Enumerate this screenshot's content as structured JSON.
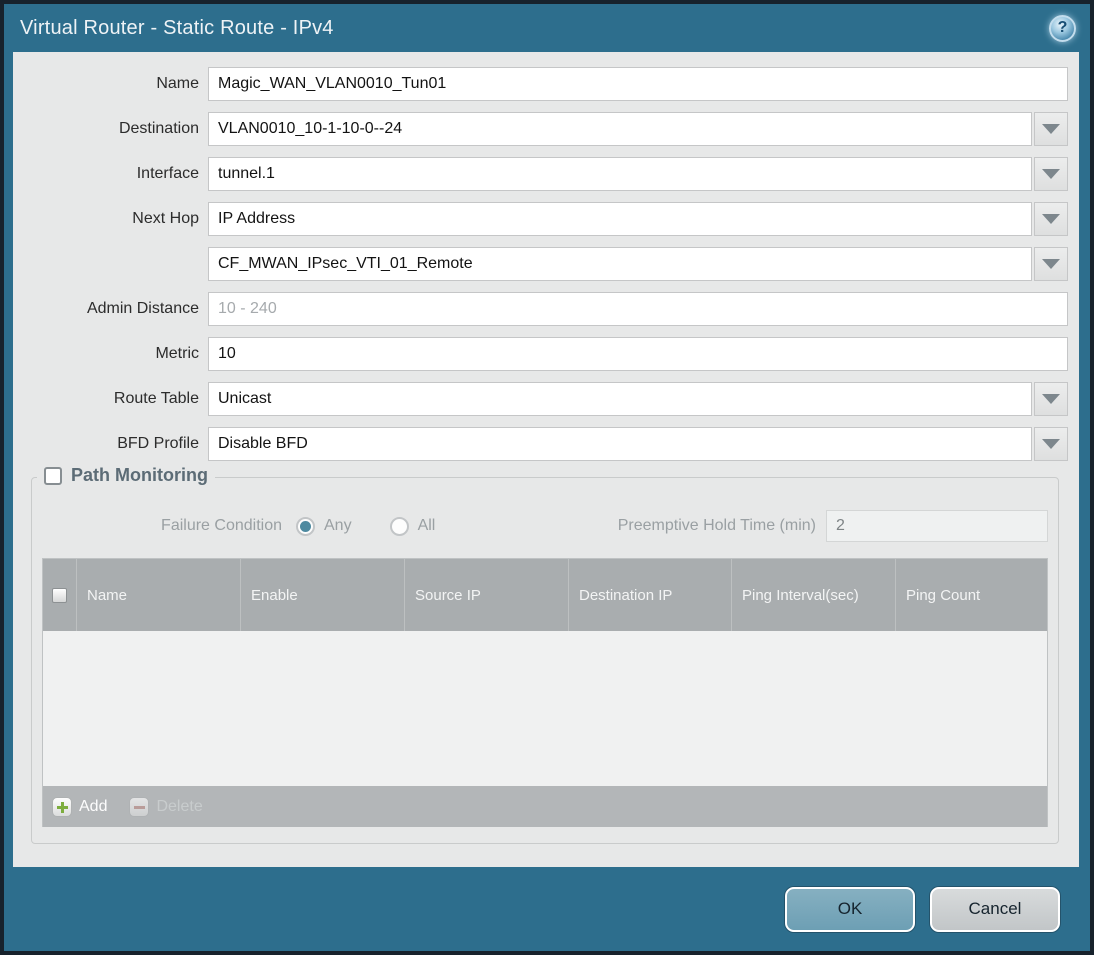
{
  "window": {
    "title": "Virtual Router - Static Route - IPv4",
    "help_glyph": "?"
  },
  "colors": {
    "frame_teal": "#2d6e8d",
    "frame_border": "#17222c",
    "content_bg": "#e7e8e8",
    "table_header_bg": "#a9adaf",
    "ok_button": "#74a5b9",
    "add_plus_green": "#7dad3e",
    "delete_minus_red": "#bd8f8a",
    "radio_selected": "#4e8aa0"
  },
  "form": {
    "rows": [
      {
        "label": "Name",
        "value": "Magic_WAN_VLAN0010_Tun01",
        "type": "text"
      },
      {
        "label": "Destination",
        "value": "VLAN0010_10-1-10-0--24",
        "type": "dropdown"
      },
      {
        "label": "Interface",
        "value": "tunnel.1",
        "type": "dropdown"
      },
      {
        "label": "Next Hop",
        "value": "IP Address",
        "type": "dropdown"
      },
      {
        "label": "",
        "value": "CF_MWAN_IPsec_VTI_01_Remote",
        "type": "dropdown"
      },
      {
        "label": "Admin Distance",
        "value": "",
        "placeholder": "10 - 240",
        "type": "text"
      },
      {
        "label": "Metric",
        "value": "10",
        "type": "text"
      },
      {
        "label": "Route Table",
        "value": "Unicast",
        "type": "dropdown"
      },
      {
        "label": "BFD Profile",
        "value": "Disable BFD",
        "type": "dropdown"
      }
    ]
  },
  "path_monitoring": {
    "legend": "Path Monitoring",
    "checked": false,
    "failure_condition_label": "Failure Condition",
    "options": [
      {
        "label": "Any",
        "selected": true
      },
      {
        "label": "All",
        "selected": false
      }
    ],
    "preemptive_label": "Preemptive Hold Time (min)",
    "preemptive_value": "2",
    "table": {
      "columns": [
        "Name",
        "Enable",
        "Source IP",
        "Destination IP",
        "Ping Interval(sec)",
        "Ping Count"
      ],
      "rows": [],
      "add_label": "Add",
      "delete_label": "Delete"
    }
  },
  "footer": {
    "ok_label": "OK",
    "cancel_label": "Cancel"
  }
}
